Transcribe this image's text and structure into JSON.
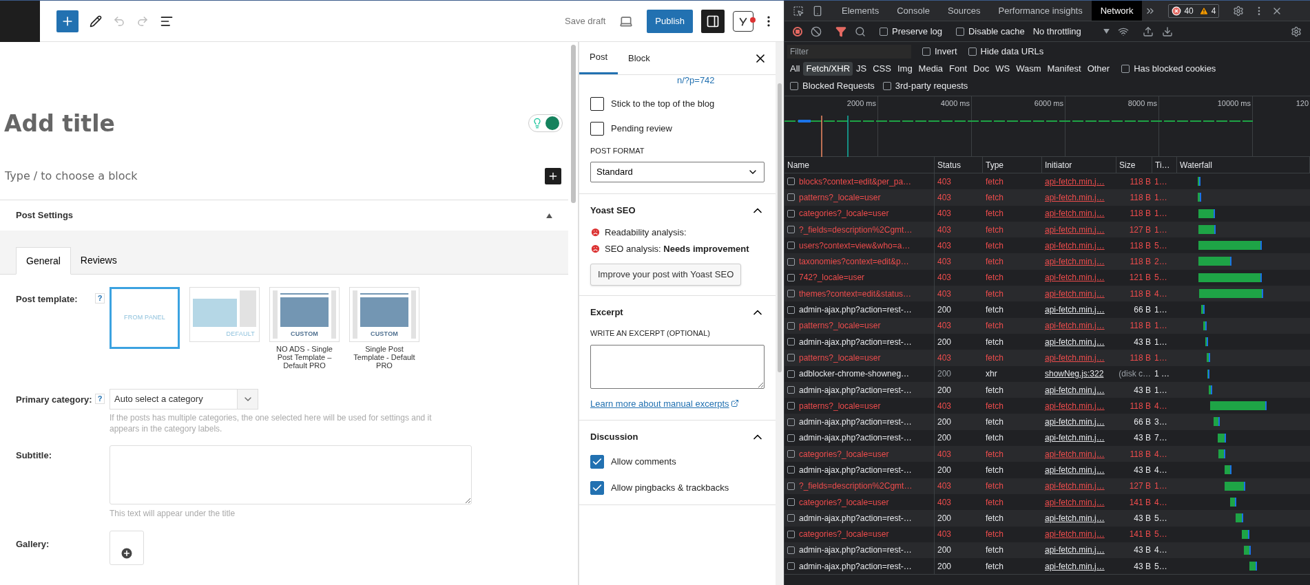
{
  "editor_toolbar": {
    "save_draft": "Save draft",
    "publish": "Publish"
  },
  "editor": {
    "title_placeholder": "Add title",
    "block_placeholder": "Type / to choose a block"
  },
  "post_settings": {
    "title": "Post Settings",
    "expanded": true,
    "tabs": [
      {
        "label": "General",
        "selected": true
      },
      {
        "label": "Reviews",
        "selected": false
      }
    ],
    "post_template": {
      "label": "Post template:",
      "help": "?",
      "options": [
        {
          "kind": "panel",
          "thumb_label": "FROM PANEL",
          "selected": true
        },
        {
          "kind": "default",
          "thumb_label": "DEFAULT",
          "selected": false
        },
        {
          "kind": "custom",
          "thumb_label": "CUSTOM",
          "caption": "NO ADS - Single Post Template – Default PRO",
          "selected": false
        },
        {
          "kind": "custom",
          "thumb_label": "CUSTOM",
          "caption": "Single Post Template - Default PRO",
          "selected": false
        }
      ]
    },
    "primary_category": {
      "label": "Primary category:",
      "help": "?",
      "value": "Auto select a category",
      "hint": "If the posts has multiple categories, the one selected here will be used for settings and it appears in the category labels."
    },
    "subtitle": {
      "label": "Subtitle:",
      "hint": "This text will appear under the title"
    },
    "gallery": {
      "label": "Gallery:"
    }
  },
  "sidebar": {
    "tabs": [
      {
        "label": "Post",
        "selected": true
      },
      {
        "label": "Block",
        "selected": false
      }
    ],
    "permalink": "n/?p=742",
    "checkboxes": [
      {
        "label": "Stick to the top of the blog",
        "checked": false
      },
      {
        "label": "Pending review",
        "checked": false
      }
    ],
    "post_format": {
      "label": "POST FORMAT",
      "value": "Standard"
    },
    "yoast": {
      "title": "Yoast SEO",
      "expanded": true,
      "analyses": [
        "Readability analysis:",
        "SEO analysis: **Needs improvement**"
      ],
      "button": "Improve your post with Yoast SEO"
    },
    "excerpt": {
      "title": "Excerpt",
      "expanded": true,
      "label": "WRITE AN EXCERPT (OPTIONAL)",
      "link": "Learn more about manual excerpts"
    },
    "discussion": {
      "title": "Discussion",
      "expanded": true,
      "checkboxes": [
        {
          "label": "Allow comments",
          "checked": true
        },
        {
          "label": "Allow pingbacks & trackbacks",
          "checked": true
        }
      ]
    }
  },
  "devtools": {
    "tabs": [
      {
        "label": "Elements",
        "selected": false
      },
      {
        "label": "Console",
        "selected": false
      },
      {
        "label": "Sources",
        "selected": false
      },
      {
        "label": "Performance insights",
        "selected": false
      },
      {
        "label": "Network",
        "selected": true
      }
    ],
    "errors": "40",
    "warnings": "4",
    "preserve_log": {
      "label": "Preserve log",
      "checked": false
    },
    "disable_cache": {
      "label": "Disable cache",
      "checked": false
    },
    "throttling": "No throttling",
    "filter": {
      "placeholder": "Filter"
    },
    "invert": {
      "label": "Invert",
      "checked": false
    },
    "hide_data_urls": {
      "label": "Hide data URLs",
      "checked": false
    },
    "types": [
      {
        "label": "All",
        "selected": false
      },
      {
        "label": "Fetch/XHR",
        "selected": true
      },
      {
        "label": "JS",
        "selected": false
      },
      {
        "label": "CSS",
        "selected": false
      },
      {
        "label": "Img",
        "selected": false
      },
      {
        "label": "Media",
        "selected": false
      },
      {
        "label": "Font",
        "selected": false
      },
      {
        "label": "Doc",
        "selected": false
      },
      {
        "label": "WS",
        "selected": false
      },
      {
        "label": "Wasm",
        "selected": false
      },
      {
        "label": "Manifest",
        "selected": false
      },
      {
        "label": "Other",
        "selected": false
      }
    ],
    "has_blocked_cookies": {
      "label": "Has blocked cookies",
      "checked": false
    },
    "blocked_requests": {
      "label": "Blocked Requests",
      "checked": false
    },
    "third_party": {
      "label": "3rd-party requests",
      "checked": false
    },
    "overview_ticks": [
      "2000 ms",
      "4000 ms",
      "6000 ms",
      "8000 ms",
      "10000 ms",
      "120"
    ],
    "columns": [
      "Name",
      "Status",
      "Type",
      "Initiator",
      "Size",
      "Ti…",
      "Waterfall"
    ],
    "rows": [
      {
        "name": "blocks?context=edit&per_pa…",
        "status": "403",
        "type": "fetch",
        "initiator": "api-fetch.min.j…",
        "size": "118 B",
        "time": "1…",
        "failed": true,
        "cached": false,
        "checked": false
      },
      {
        "name": "patterns?_locale=user",
        "status": "403",
        "type": "fetch",
        "initiator": "api-fetch.min.j…",
        "size": "118 B",
        "time": "1…",
        "failed": true,
        "cached": false,
        "checked": false
      },
      {
        "name": "categories?_locale=user",
        "status": "403",
        "type": "fetch",
        "initiator": "api-fetch.min.j…",
        "size": "118 B",
        "time": "1…",
        "failed": true,
        "cached": false,
        "checked": false
      },
      {
        "name": "?_fields=description%2Cgmt…",
        "status": "403",
        "type": "fetch",
        "initiator": "api-fetch.min.j…",
        "size": "127 B",
        "time": "1…",
        "failed": true,
        "cached": false,
        "checked": false
      },
      {
        "name": "users?context=view&who=a…",
        "status": "403",
        "type": "fetch",
        "initiator": "api-fetch.min.j…",
        "size": "118 B",
        "time": "5…",
        "failed": true,
        "cached": false,
        "checked": false
      },
      {
        "name": "taxonomies?context=edit&p…",
        "status": "403",
        "type": "fetch",
        "initiator": "api-fetch.min.j…",
        "size": "118 B",
        "time": "2…",
        "failed": true,
        "cached": false,
        "checked": false
      },
      {
        "name": "742?_locale=user",
        "status": "403",
        "type": "fetch",
        "initiator": "api-fetch.min.j…",
        "size": "121 B",
        "time": "5…",
        "failed": true,
        "cached": false,
        "checked": false
      },
      {
        "name": "themes?context=edit&status…",
        "status": "403",
        "type": "fetch",
        "initiator": "api-fetch.min.j…",
        "size": "118 B",
        "time": "4…",
        "failed": true,
        "cached": false,
        "checked": false
      },
      {
        "name": "admin-ajax.php?action=rest-…",
        "status": "200",
        "type": "fetch",
        "initiator": "api-fetch.min.j…",
        "size": "66 B",
        "time": "1…",
        "failed": false,
        "cached": false,
        "checked": false
      },
      {
        "name": "patterns?_locale=user",
        "status": "403",
        "type": "fetch",
        "initiator": "api-fetch.min.j…",
        "size": "118 B",
        "time": "1…",
        "failed": true,
        "cached": false,
        "checked": false
      },
      {
        "name": "admin-ajax.php?action=rest-…",
        "status": "200",
        "type": "fetch",
        "initiator": "api-fetch.min.j…",
        "size": "43 B",
        "time": "1…",
        "failed": false,
        "cached": false,
        "checked": false
      },
      {
        "name": "patterns?_locale=user",
        "status": "403",
        "type": "fetch",
        "initiator": "api-fetch.min.j…",
        "size": "118 B",
        "time": "1…",
        "failed": true,
        "cached": false,
        "checked": false
      },
      {
        "name": "adblocker-chrome-showneg…",
        "status": "200",
        "type": "xhr",
        "initiator": "showNeg.js:322",
        "size": "(disk c…",
        "time": "1 …",
        "failed": false,
        "cached": true,
        "checked": false
      },
      {
        "name": "admin-ajax.php?action=rest-…",
        "status": "200",
        "type": "fetch",
        "initiator": "api-fetch.min.j…",
        "size": "43 B",
        "time": "1…",
        "failed": false,
        "cached": false,
        "checked": false
      },
      {
        "name": "patterns?_locale=user",
        "status": "403",
        "type": "fetch",
        "initiator": "api-fetch.min.j…",
        "size": "118 B",
        "time": "4…",
        "failed": true,
        "cached": false,
        "checked": false
      },
      {
        "name": "admin-ajax.php?action=rest-…",
        "status": "200",
        "type": "fetch",
        "initiator": "api-fetch.min.j…",
        "size": "66 B",
        "time": "3…",
        "failed": false,
        "cached": false,
        "checked": false
      },
      {
        "name": "admin-ajax.php?action=rest-…",
        "status": "200",
        "type": "fetch",
        "initiator": "api-fetch.min.j…",
        "size": "43 B",
        "time": "7…",
        "failed": false,
        "cached": false,
        "checked": false
      },
      {
        "name": "categories?_locale=user",
        "status": "403",
        "type": "fetch",
        "initiator": "api-fetch.min.j…",
        "size": "118 B",
        "time": "4…",
        "failed": true,
        "cached": false,
        "checked": false
      },
      {
        "name": "admin-ajax.php?action=rest-…",
        "status": "200",
        "type": "fetch",
        "initiator": "api-fetch.min.j…",
        "size": "43 B",
        "time": "4…",
        "failed": false,
        "cached": false,
        "checked": false
      },
      {
        "name": "?_fields=description%2Cgmt…",
        "status": "403",
        "type": "fetch",
        "initiator": "api-fetch.min.j…",
        "size": "127 B",
        "time": "1…",
        "failed": true,
        "cached": false,
        "checked": false
      },
      {
        "name": "categories?_locale=user",
        "status": "403",
        "type": "fetch",
        "initiator": "api-fetch.min.j…",
        "size": "141 B",
        "time": "4…",
        "failed": true,
        "cached": false,
        "checked": false
      },
      {
        "name": "admin-ajax.php?action=rest-…",
        "status": "200",
        "type": "fetch",
        "initiator": "api-fetch.min.j…",
        "size": "43 B",
        "time": "5…",
        "failed": false,
        "cached": false,
        "checked": false
      },
      {
        "name": "categories?_locale=user",
        "status": "403",
        "type": "fetch",
        "initiator": "api-fetch.min.j…",
        "size": "141 B",
        "time": "5…",
        "failed": true,
        "cached": false,
        "checked": false
      },
      {
        "name": "admin-ajax.php?action=rest-…",
        "status": "200",
        "type": "fetch",
        "initiator": "api-fetch.min.j…",
        "size": "43 B",
        "time": "4…",
        "failed": false,
        "cached": false,
        "checked": false
      },
      {
        "name": "admin-ajax.php?action=rest-…",
        "status": "200",
        "type": "fetch",
        "initiator": "api-fetch.min.j…",
        "size": "43 B",
        "time": "5…",
        "failed": false,
        "cached": false,
        "checked": false
      }
    ]
  }
}
